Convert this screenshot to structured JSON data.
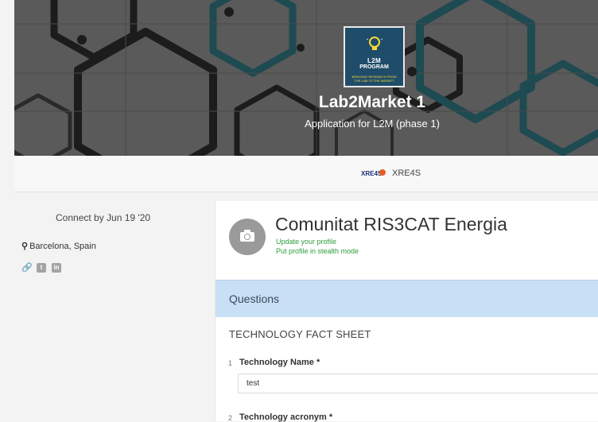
{
  "hero": {
    "logo": {
      "line1": "L2M",
      "line2": "PROGRAM",
      "tagline": "BRIDGING RESEARCH FROM THE LAB TO THE MARKET"
    },
    "title": "Lab2Market 1",
    "subtitle": "Application for L2M (phase 1)"
  },
  "org_bar": {
    "logo_text": "XRE4S",
    "name": "XRE4S"
  },
  "left": {
    "deadline": "Connect by Jun 19 '20",
    "location": "Barcelona, Spain",
    "social_icons": [
      "link-icon",
      "twitter-icon",
      "linkedin-icon"
    ]
  },
  "profile": {
    "name": "Comunitat RIS3CAT Energia",
    "update_link": "Update your profile",
    "stealth_link": "Put profile in stealth mode"
  },
  "questions": {
    "header": "Questions",
    "section": "TECHNOLOGY FACT SHEET",
    "items": [
      {
        "num": "1",
        "label": "Technology Name *",
        "value": "test"
      },
      {
        "num": "2",
        "label": "Technology acronym *"
      }
    ]
  },
  "colors": {
    "accent_green": "#2e9e3c",
    "question_bar": "#c8dff6",
    "logo_bg": "#1f4d69"
  }
}
